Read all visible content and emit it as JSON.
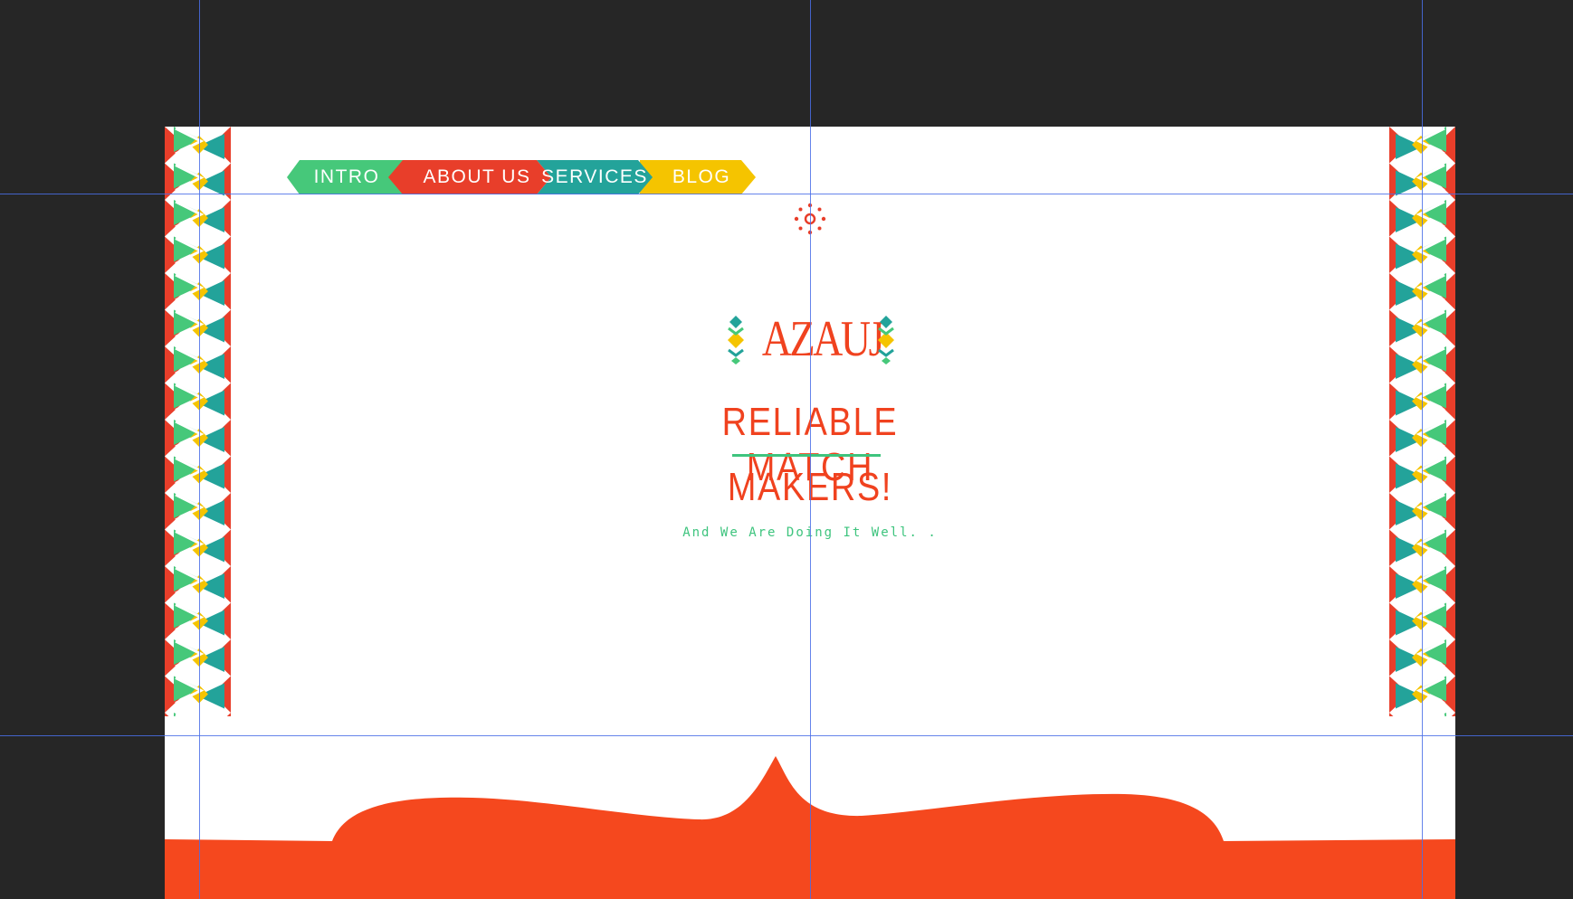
{
  "nav": {
    "items": [
      {
        "label": "INTRO",
        "color": "#46c87a"
      },
      {
        "label": "ABOUT US",
        "color": "#e83e2a"
      },
      {
        "label": "SERVICES",
        "color": "#23a39a"
      },
      {
        "label": "BLOG",
        "color": "#f5c400"
      }
    ]
  },
  "logo": {
    "text": "AZAUJ"
  },
  "hero": {
    "headline_line1": "RELIABLE MATCH",
    "headline_line2": "MAKERS!",
    "tagline": "And We Are Doing It Well. ."
  },
  "icons": {
    "top_ornament": "sunburst-dots-icon",
    "logo_ornament": "diamond-chevron-icon",
    "border": "tribal-zigzag-pattern"
  },
  "colors": {
    "canvas_background": "#262626",
    "artboard_background": "#ffffff",
    "primary_red": "#f5481e",
    "accent_green": "#46c87a",
    "accent_teal": "#23a39a",
    "accent_yellow": "#f5c400",
    "guide_lines": "#4a6fe8"
  }
}
